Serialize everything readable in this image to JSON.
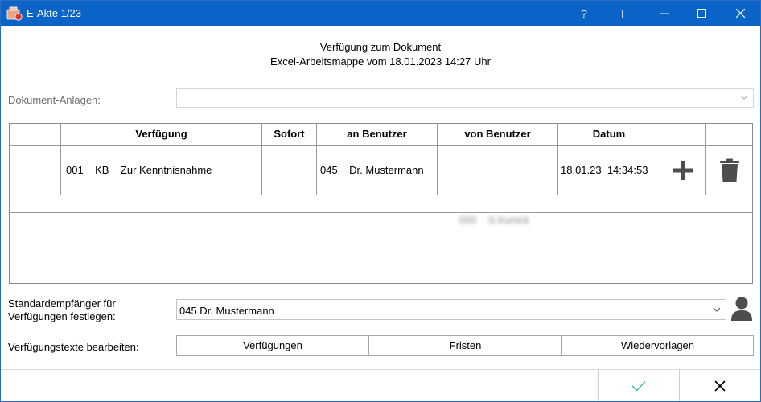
{
  "window": {
    "title": "E-Akte 1/23",
    "help_label": "?",
    "cursor_label": "I"
  },
  "header": {
    "line1": "Verfügung  zum  Dokument",
    "line2": "Excel-Arbeitsmappe vom 18.01.2023 14:27 Uhr"
  },
  "attachments": {
    "label": "Dokument-Anlagen:",
    "value": ""
  },
  "table": {
    "columns": [
      "Verfügung",
      "Sofort",
      "an Benutzer",
      "von Benutzer",
      "Datum"
    ],
    "rows": [
      {
        "verfuegung": "001    KB    Zur Kenntnisnahme",
        "sofort": "",
        "an_benutzer": "045    Dr. Mustermann",
        "von_benutzer": "000    S.Kunick",
        "datum": "18.01.23  14:34:53"
      }
    ]
  },
  "default_recipient": {
    "label_line1": "Standardempfänger für",
    "label_line2": "Verfügungen festlegen:",
    "value": "045    Dr. Mustermann"
  },
  "texts": {
    "label": "Verfügungstexte bearbeiten:",
    "buttons": [
      "Verfügungen",
      "Fristen",
      "Wiedervorlagen"
    ]
  },
  "colors": {
    "titlebar": "#0a64c8",
    "ok_check": "#5ab9a6",
    "icon_gray": "#4d4d4d"
  }
}
